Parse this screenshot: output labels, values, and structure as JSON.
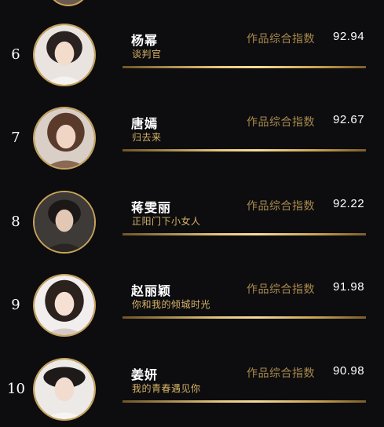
{
  "metric_label": "作品综合指数",
  "ranking": [
    {
      "rank": "6",
      "name": "杨幂",
      "work": "谈判官",
      "score": "92.94"
    },
    {
      "rank": "7",
      "name": "唐嫣",
      "work": "归去来",
      "score": "92.67"
    },
    {
      "rank": "8",
      "name": "蒋雯丽",
      "work": "正阳门下小女人",
      "score": "92.22"
    },
    {
      "rank": "9",
      "name": "赵丽颖",
      "work": "你和我的倾城时光",
      "score": "91.98"
    },
    {
      "rank": "10",
      "name": "姜妍",
      "work": "我的青春遇见你",
      "score": "90.98"
    }
  ],
  "colors": {
    "background": "#0d0d0f",
    "gold": "#c9a45a",
    "work_title": "#d8b468",
    "metric_label": "#a8894d"
  }
}
